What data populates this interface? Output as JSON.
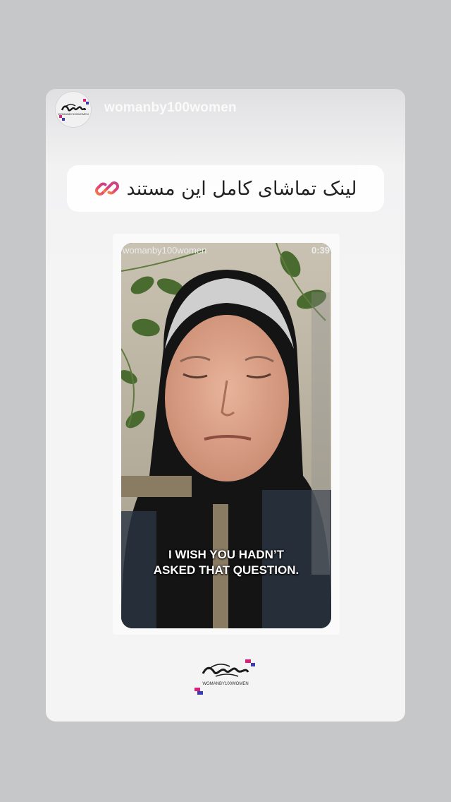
{
  "story": {
    "username": "womanby100women",
    "avatar_label": "WOMANBY100WOMEN"
  },
  "link_sticker": {
    "text": "لینک تماشای کامل این مستند",
    "icon": "link-icon"
  },
  "video": {
    "username": "womanby100women",
    "duration": "0:39",
    "caption": "I WISH YOU HADN’T\nASKED THAT QUESTION."
  },
  "footer": {
    "logo_label": "WOMANBY100WOMEN"
  },
  "colors": {
    "background": "#c6c7c9",
    "card": "#f4f4f5",
    "sticker_gradient_start": "#f77737",
    "sticker_gradient_end": "#c13584"
  }
}
